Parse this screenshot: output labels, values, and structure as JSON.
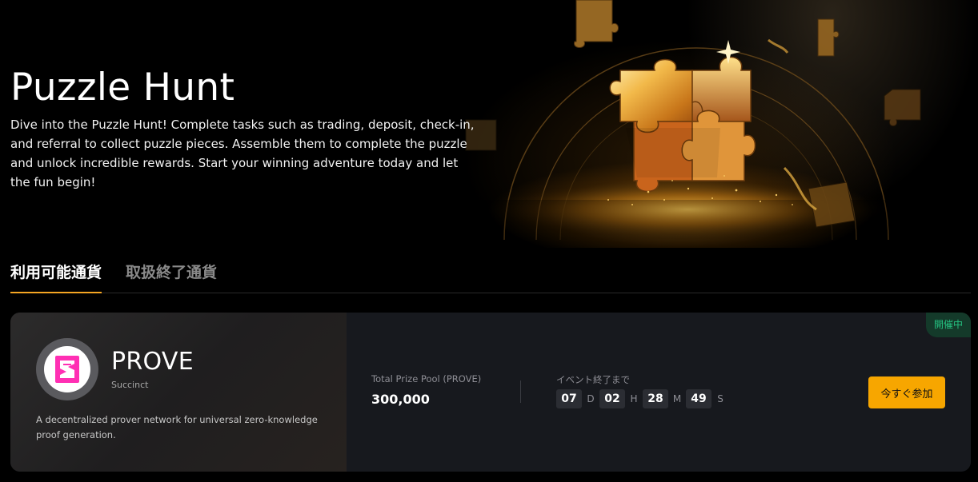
{
  "hero": {
    "title": "Puzzle Hunt",
    "description": "Dive into the Puzzle Hunt! Complete tasks such as trading, deposit, check-in, and referral to collect puzzle pieces. Assemble them to complete the puzzle and unlock incredible rewards. Start your winning adventure today and let the fun begin!"
  },
  "tabs": [
    {
      "label": "利用可能通貨",
      "active": true
    },
    {
      "label": "取扱終了通貨",
      "active": false
    }
  ],
  "event": {
    "token_name": "PROVE",
    "token_project": "Succinct",
    "token_description": "A decentralized prover network for universal zero-knowledge proof generation.",
    "prize_pool_label": "Total Prize Pool (PROVE)",
    "prize_pool_value": "300,000",
    "countdown_label": "イベント終了まで",
    "countdown": {
      "days": "07",
      "days_unit": "D",
      "hours": "02",
      "hours_unit": "H",
      "minutes": "28",
      "minutes_unit": "M",
      "seconds": "49",
      "seconds_unit": "S"
    },
    "join_label": "今すぐ参加",
    "status": "開催中"
  },
  "colors": {
    "accent": "#f7a600",
    "tab_underline": "#f5a623",
    "status_green": "#25c281",
    "logo_pink": "#ff2fb3",
    "card_bg": "#17191e"
  },
  "icons": {
    "token_logo": "succinct-logo-icon",
    "hero_art": "golden-puzzle-pieces-illustration"
  }
}
